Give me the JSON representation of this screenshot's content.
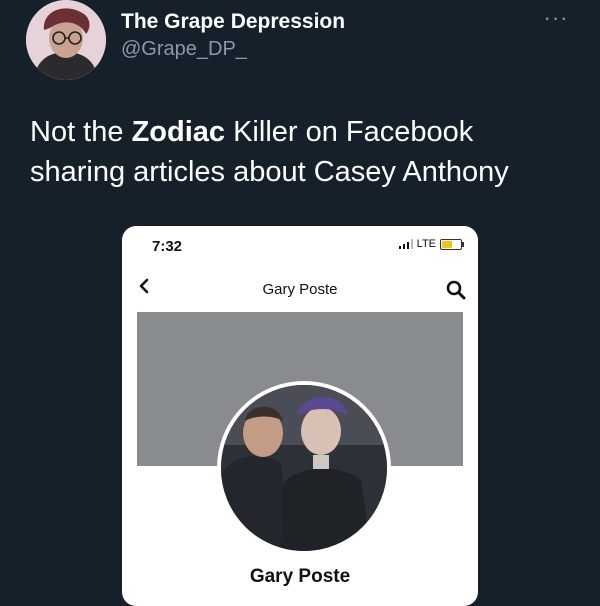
{
  "tweet": {
    "author_name": "The Grape Depression",
    "handle": "@Grape_DP_",
    "more_icon": "more-horizontal-icon",
    "text_before": "Not the ",
    "text_bold": "Zodiac",
    "text_after": " Killer on Facebook sharing articles about Casey Anthony"
  },
  "screenshot": {
    "status_time": "7:32",
    "network": "LTE",
    "battery_color": "#f2c318",
    "nav_title": "Gary Poste",
    "back_icon": "chevron-left-icon",
    "search_icon": "search-icon",
    "profile_name": "Gary Poste"
  },
  "colors": {
    "background": "#15202b",
    "secondary_text": "#8b98a5",
    "cover": "#898c8f"
  }
}
